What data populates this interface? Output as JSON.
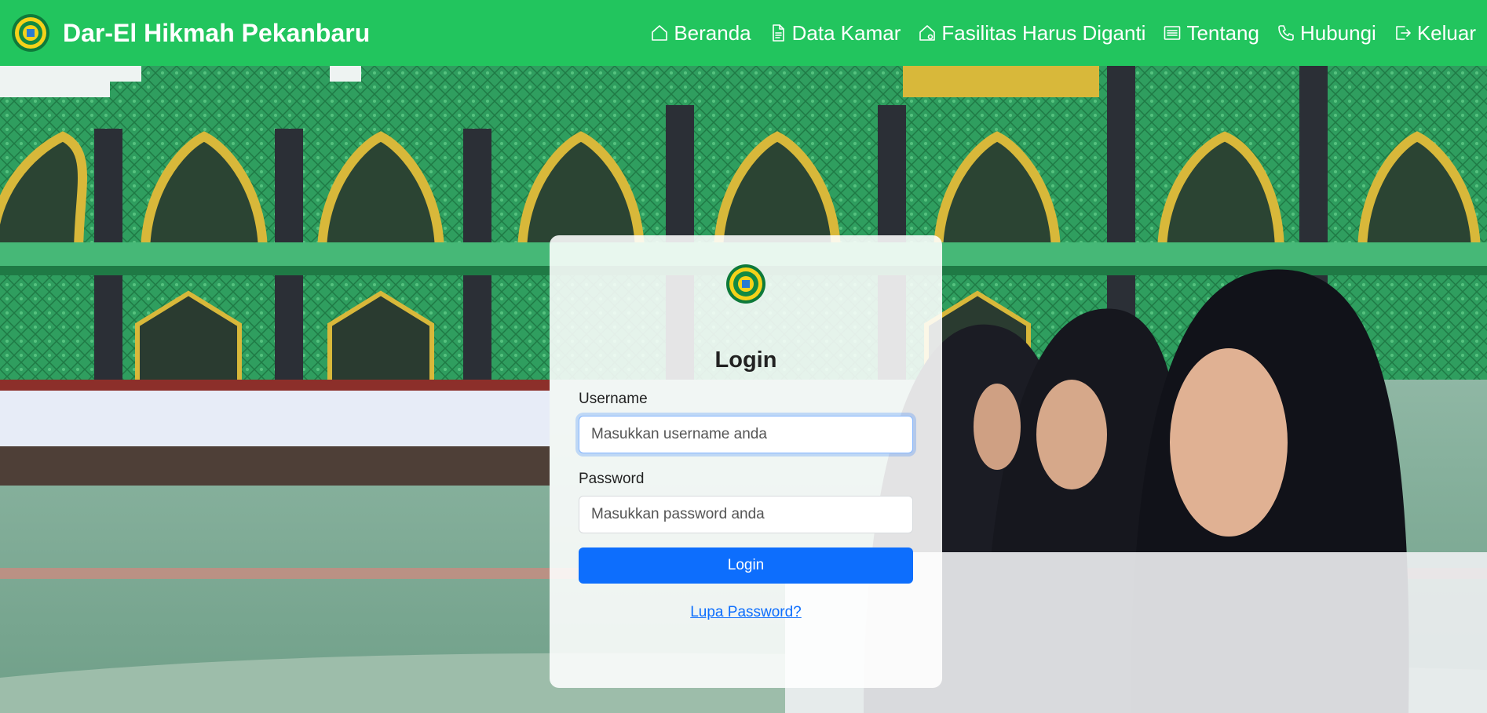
{
  "navbar": {
    "brand": "Dar-El Hikmah Pekanbaru",
    "items": [
      {
        "label": "Beranda",
        "icon": "house-icon"
      },
      {
        "label": "Data Kamar",
        "icon": "file-text-icon"
      },
      {
        "label": "Fasilitas Harus Diganti",
        "icon": "house-gear-icon"
      },
      {
        "label": "Tentang",
        "icon": "list-icon"
      },
      {
        "label": "Hubungi",
        "icon": "phone-icon"
      },
      {
        "label": "Keluar",
        "icon": "logout-icon"
      }
    ]
  },
  "login": {
    "title": "Login",
    "username_label": "Username",
    "username_placeholder": "Masukkan username anda",
    "password_label": "Password",
    "password_placeholder": "Masukkan password anda",
    "submit_label": "Login",
    "forgot_label": "Lupa Password?"
  },
  "colors": {
    "navbar": "#22c55e",
    "primary": "#0d6efd",
    "mosque_green": "#2f9e5f",
    "mosque_gold": "#d8b83a"
  }
}
